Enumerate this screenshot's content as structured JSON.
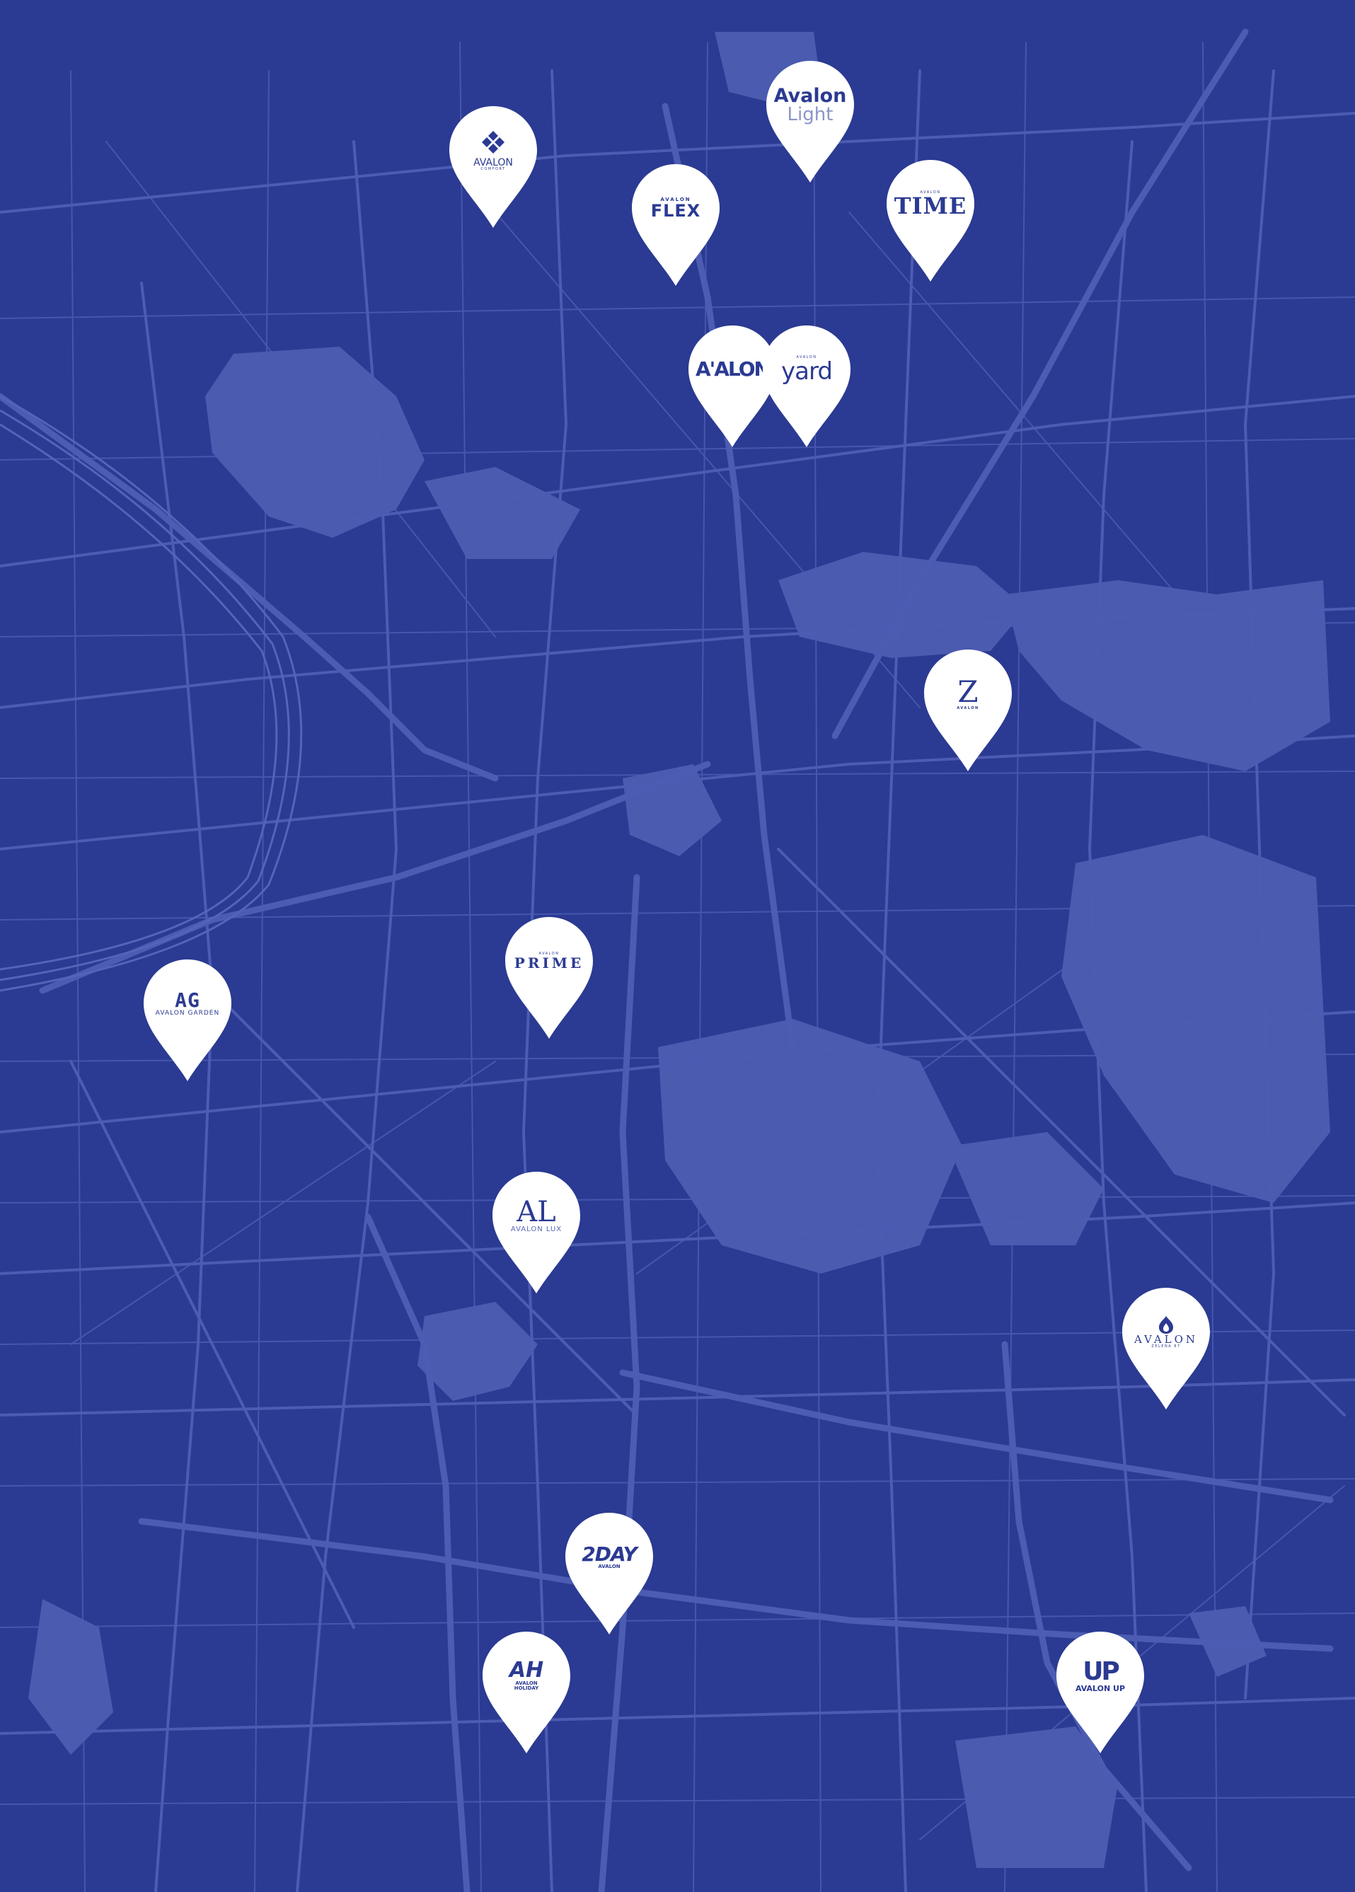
{
  "map": {
    "background": "#2b3a92",
    "land_fill": "#4a5bb0",
    "road_color": "#4656ae",
    "pin_fill": "#ffffff",
    "logo_color": "#2b3a92"
  },
  "pins": [
    {
      "id": "avalon-comfort",
      "logo": "diamond-icon",
      "lines": [
        "AVALON",
        "COMFORT"
      ]
    },
    {
      "id": "avalon-light",
      "lines": [
        "Avalon",
        "Light"
      ]
    },
    {
      "id": "avalon-flex",
      "lines": [
        "AVALON",
        "FLEX"
      ]
    },
    {
      "id": "avalon-time",
      "lines": [
        "AVALON",
        "TIME"
      ]
    },
    {
      "id": "avalon",
      "lines": [
        "A'ALON"
      ]
    },
    {
      "id": "avalon-yard",
      "lines": [
        "AVALON",
        "yard"
      ]
    },
    {
      "id": "avalon-z",
      "lines": [
        "Z",
        "AVALON"
      ]
    },
    {
      "id": "avalon-prime",
      "lines": [
        "AVALON",
        "PRIME"
      ]
    },
    {
      "id": "avalon-garden",
      "lines": [
        "AG",
        "AVALON GARDEN"
      ]
    },
    {
      "id": "avalon-lux",
      "lines": [
        "AL",
        "AVALON LUX"
      ]
    },
    {
      "id": "avalon-zelena",
      "logo": "house-flame-icon",
      "lines": [
        "AVALON",
        "ZELENA 87"
      ]
    },
    {
      "id": "avalon-2day",
      "lines": [
        "2DAY",
        "AVALON"
      ]
    },
    {
      "id": "avalon-holiday",
      "lines": [
        "AH",
        "AVALON",
        "HOLIDAY"
      ]
    },
    {
      "id": "avalon-up",
      "lines": [
        "UP",
        "AVALON UP"
      ]
    }
  ]
}
